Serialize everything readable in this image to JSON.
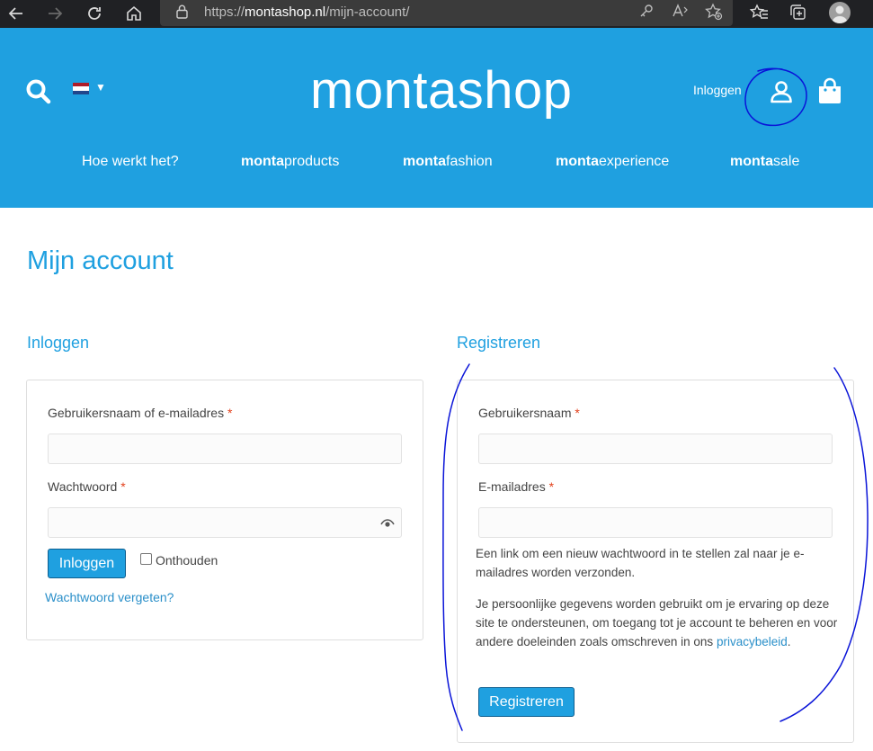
{
  "browser": {
    "url_prefix": "https://",
    "url_domain": "montashop.nl",
    "url_path": "/mijn-account/",
    "icons": {
      "back": "back-arrow-icon",
      "forward": "forward-arrow-icon",
      "reload": "reload-icon",
      "home": "home-icon",
      "lock": "lock-icon",
      "key": "key-icon",
      "read_aloud": "read-aloud-icon",
      "favorite": "add-favorite-icon",
      "favorites": "favorites-icon",
      "collections": "collections-icon",
      "profile": "profile-avatar"
    }
  },
  "header": {
    "logo_bold": "monta",
    "logo_light": "shop",
    "login_label": "Inloggen",
    "nav": [
      {
        "prefix": "",
        "label": "Hoe werkt het?"
      },
      {
        "prefix": "monta",
        "label": "products"
      },
      {
        "prefix": "monta",
        "label": "fashion"
      },
      {
        "prefix": "monta",
        "label": "experience"
      },
      {
        "prefix": "monta",
        "label": "sale"
      }
    ],
    "colors": {
      "header_bg": "#1fa0e0",
      "text": "#ffffff"
    }
  },
  "page": {
    "title": "Mijn account"
  },
  "login": {
    "heading": "Inloggen",
    "username_label": "Gebruikersnaam of e-mailadres",
    "username_value": "",
    "password_label": "Wachtwoord",
    "password_value": "",
    "required_mark": "*",
    "submit_label": "Inloggen",
    "remember_label": "Onthouden",
    "remember_checked": false,
    "forgot_label": "Wachtwoord vergeten?"
  },
  "register": {
    "heading": "Registreren",
    "username_label": "Gebruikersnaam",
    "username_value": "",
    "email_label": "E-mailadres",
    "email_value": "",
    "required_mark": "*",
    "info_text": "Een link om een nieuw wachtwoord in te stellen zal naar je e-mailadres worden verzonden.",
    "privacy_text": "Je persoonlijke gegevens worden gebruikt om je ervaring op deze site te ondersteunen, om toegang tot je account te beheren en voor andere doeleinden zoals omschreven in ons",
    "privacy_link": "privacybeleid",
    "privacy_end": ".",
    "submit_label": "Registreren"
  },
  "colors": {
    "accent": "#1fa0e0",
    "required": "#e2401c",
    "link": "#2a8fc9",
    "annotation": "#0a14d8"
  }
}
